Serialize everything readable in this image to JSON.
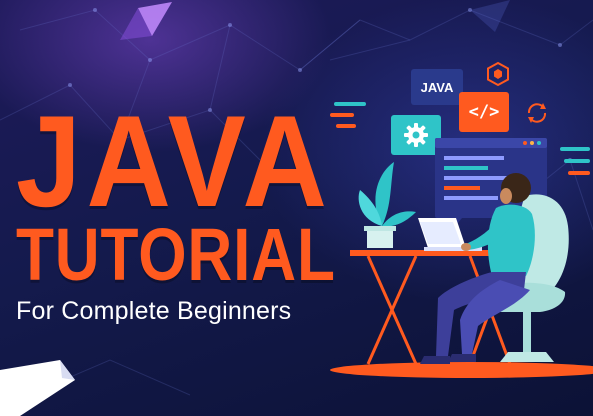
{
  "title": {
    "line1": "JAVA",
    "line2": "TUTORIAL",
    "subtitle": "For Complete Beginners"
  },
  "badges": {
    "java": "JAVA",
    "code": "</>"
  },
  "icons": [
    "hexagon-code-icon",
    "refresh-icon",
    "gear-icon",
    "code-icon"
  ],
  "colors": {
    "accent": "#ff5a1f",
    "teal": "#2fc4c8",
    "background": "#141a4d",
    "badge_blue": "#2a3a8c"
  }
}
